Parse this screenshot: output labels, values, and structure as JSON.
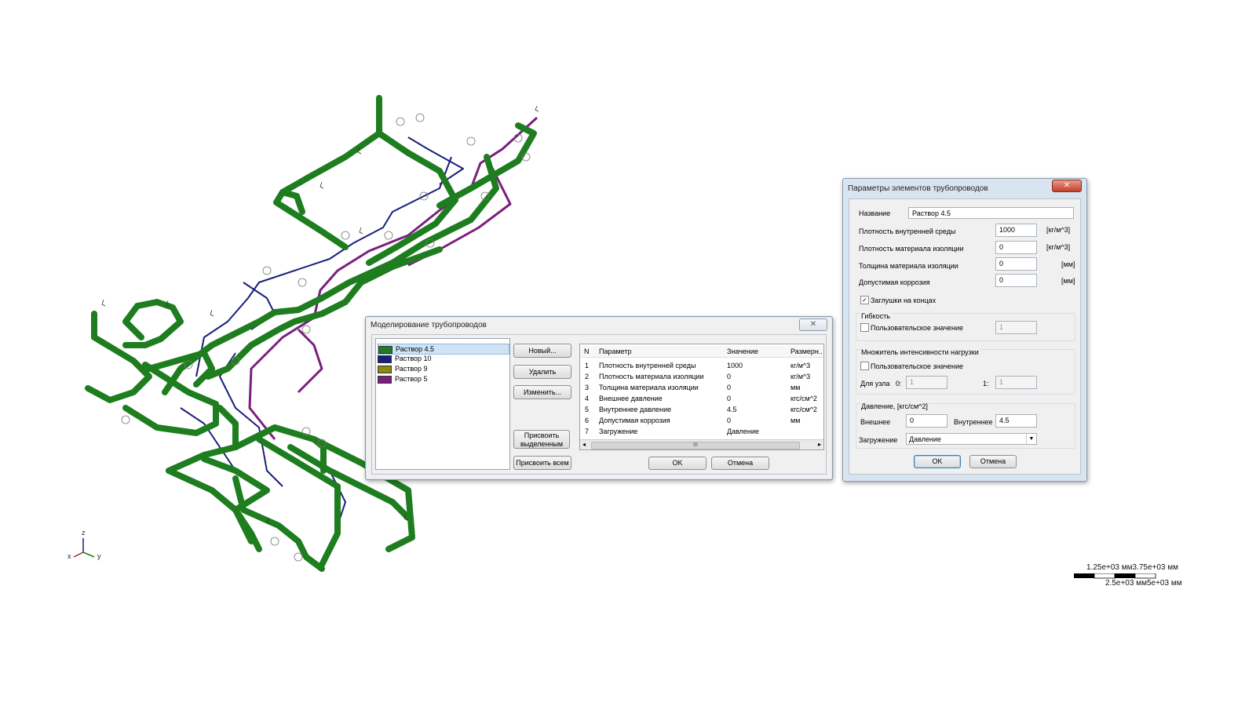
{
  "colors": {
    "pipe_green": "#1e7d1e",
    "pipe_navy": "#1a1f7a",
    "pipe_purple": "#7a1f7e",
    "pipe_olive": "#8a8a12"
  },
  "axes": {
    "z": "z",
    "y": "y",
    "x": "x"
  },
  "scale": {
    "top": "1.25e+03 мм3.75e+03 мм",
    "bottom": "2.5e+03 мм5e+03 мм"
  },
  "dialog_model": {
    "title": "Моделирование трубопроводов",
    "close": "✕",
    "materials": [
      {
        "label": "Раствор 4.5",
        "color": "#1e7d1e",
        "selected": true
      },
      {
        "label": "Раствор 10",
        "color": "#1a1f7a",
        "selected": false
      },
      {
        "label": "Раствор 9",
        "color": "#8a8a12",
        "selected": false
      },
      {
        "label": "Раствор 5",
        "color": "#7a1f7e",
        "selected": false
      }
    ],
    "buttons": {
      "new": "Новый...",
      "delete": "Удалить",
      "edit": "Изменить...",
      "assign_selected": "Присвоить выделенным",
      "assign_all": "Присвоить всем"
    },
    "table": {
      "headers": [
        "N",
        "Параметр",
        "Значение",
        "Размерн.."
      ],
      "rows": [
        [
          "1",
          "Плотность внутренней среды",
          "1000",
          "кг/м^3"
        ],
        [
          "2",
          "Плотность материала изоляции",
          "0",
          "кг/м^3"
        ],
        [
          "3",
          "Толщина материала изоляции",
          "0",
          "мм"
        ],
        [
          "4",
          "Внешнее давление",
          "0",
          "кгс/см^2"
        ],
        [
          "5",
          "Внутреннее давление",
          "4.5",
          "кгс/см^2"
        ],
        [
          "6",
          "Допустимая коррозия",
          "0",
          "мм"
        ],
        [
          "7",
          "Загружение",
          "Давление",
          ""
        ]
      ],
      "scroll_grip": "III"
    },
    "ok": "OK",
    "cancel": "Отмена"
  },
  "dialog_params": {
    "title": "Параметры элементов трубопроводов",
    "close": "✕",
    "name_label": "Название",
    "name_value": "Раствор 4.5",
    "fields": [
      {
        "label": "Плотность внутренней среды",
        "value": "1000",
        "unit": "[кг/м^3]"
      },
      {
        "label": "Плотность материала изоляции",
        "value": "0",
        "unit": "[кг/м^3]"
      },
      {
        "label": "Толщина материала изоляции",
        "value": "0",
        "unit": "[мм]"
      },
      {
        "label": "Допустимая коррозия",
        "value": "0",
        "unit": "[мм]"
      }
    ],
    "end_caps": {
      "label": "Заглушки на концах",
      "checked": true,
      "mark": "✓"
    },
    "flexibility": {
      "title": "Гибкость",
      "user_label": "Пользовательское значение",
      "value": "1"
    },
    "load_factor": {
      "title": "Множитель интенсивности нагрузки",
      "user_label": "Пользовательское значение",
      "node_label": "Для узла",
      "node0": "0:",
      "node0_value": "1",
      "node1": "1:",
      "node1_value": "1"
    },
    "pressure": {
      "title": "Давление,  [кгс/см^2]",
      "ext_label": "Внешнее",
      "ext_value": "0",
      "int_label": "Внутреннее",
      "int_value": "4.5"
    },
    "loading": {
      "label": "Загружение",
      "value": "Давление",
      "arrow": "▼"
    },
    "ok": "OK",
    "cancel": "Отмена"
  }
}
